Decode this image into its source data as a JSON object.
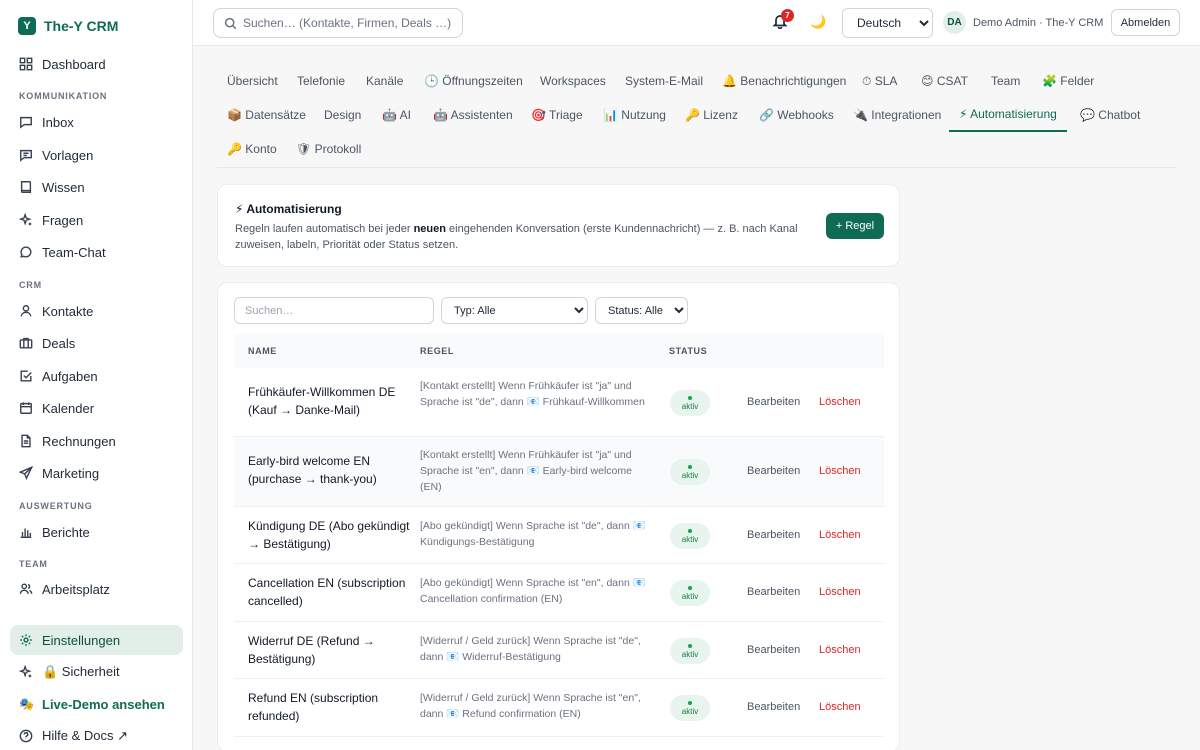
{
  "brand": {
    "logo_letter": "Y",
    "name": "The-Y CRM"
  },
  "sidebar": {
    "dashboard": "Dashboard",
    "section_communication": "KOMMUNIKATION",
    "inbox": "Inbox",
    "templates": "Vorlagen",
    "knowledge": "Wissen",
    "questions": "Fragen",
    "team_chat": "Team-Chat",
    "section_crm": "CRM",
    "contacts": "Kontakte",
    "deals": "Deals",
    "tasks": "Aufgaben",
    "calendar": "Kalender",
    "invoices": "Rechnungen",
    "marketing": "Marketing",
    "section_reporting": "AUSWERTUNG",
    "reports": "Berichte",
    "section_team": "TEAM",
    "workplace": "Arbeitsplatz",
    "settings": "Einstellungen",
    "security": "🔒 Sicherheit",
    "live_demo": "Live-Demo ansehen",
    "help": "Hilfe & Docs ↗"
  },
  "topbar": {
    "search_placeholder": "Suchen… (Kontakte, Firmen, Deals …)",
    "notification_count": "7",
    "theme_icon": "🌙",
    "language": "Deutsch",
    "avatar_initials": "DA",
    "user_label": "Demo Admin · The-Y CRM",
    "logout": "Abmelden"
  },
  "tabs": {
    "overview": "Übersicht",
    "telephony": "Telefonie",
    "channels": "Kanäle",
    "hours": "🕒 Öffnungszeiten",
    "workspaces": "Workspaces",
    "system_email": "System-E-Mail",
    "notifications": "🔔 Benachrichtigungen",
    "sla": "⏱ SLA",
    "csat": "😊 CSAT",
    "team": "Team",
    "fields": "🧩 Felder",
    "records": "📦 Datensätze",
    "design": "Design",
    "ai": "🤖 AI",
    "assistants": "🤖 Assistenten",
    "triage": "🎯 Triage",
    "usage": "📊 Nutzung",
    "license": "🔑 Lizenz",
    "webhooks": "🔗 Webhooks",
    "integrations": "🔌 Integrationen",
    "automation": "⚡ Automatisierung",
    "chatbot": "💬 Chatbot",
    "account": "🔑 Konto",
    "log": "🛡 Protokoll"
  },
  "automation": {
    "title": "⚡ Automatisierung",
    "desc_before": "Regeln laufen automatisch bei jeder ",
    "desc_bold": "neuen",
    "desc_after": " eingehenden Konversation (erste Kundennachricht) — z. B. nach Kanal zuweisen, labeln, Priorität oder Status setzen.",
    "add_rule": "+ Regel"
  },
  "filters": {
    "search_placeholder": "Suchen…",
    "type": "Typ: Alle",
    "status": "Status: Alle"
  },
  "table": {
    "col_name": "NAME",
    "col_rule": "REGEL",
    "col_status": "STATUS",
    "edit_label": "Bearbeiten",
    "delete_label": "Löschen",
    "rows": [
      {
        "name": "Frühkäufer-Willkommen DE (Kauf → Danke-Mail)",
        "rule": "[Kontakt erstellt] Wenn Frühkäufer ist \"ja\" und Sprache ist \"de\", dann 📧 Frühkauf-Willkommen",
        "status": "aktiv"
      },
      {
        "name": "Early-bird welcome EN (purchase → thank-you)",
        "rule": "[Kontakt erstellt] Wenn Frühkäufer ist \"ja\" und Sprache ist \"en\", dann 📧 Early-bird welcome (EN)",
        "status": "aktiv"
      },
      {
        "name": "Kündigung DE (Abo gekündigt → Bestätigung)",
        "rule": "[Abo gekündigt] Wenn Sprache ist \"de\", dann 📧 Kündigungs-Bestätigung",
        "status": "aktiv"
      },
      {
        "name": "Cancellation EN (subscription cancelled)",
        "rule": "[Abo gekündigt] Wenn Sprache ist \"en\", dann 📧 Cancellation confirmation (EN)",
        "status": "aktiv"
      },
      {
        "name": "Widerruf DE (Refund → Bestätigung)",
        "rule": "[Widerruf / Geld zurück] Wenn Sprache ist \"de\", dann 📧 Widerruf-Bestätigung",
        "status": "aktiv"
      },
      {
        "name": "Refund EN (subscription refunded)",
        "rule": "[Widerruf / Geld zurück] Wenn Sprache ist \"en\", dann 📧 Refund confirmation (EN)",
        "status": "aktiv"
      }
    ]
  },
  "colors": {
    "accent": "#0f6b54",
    "danger": "#dc2626",
    "success": "#16a34a"
  }
}
